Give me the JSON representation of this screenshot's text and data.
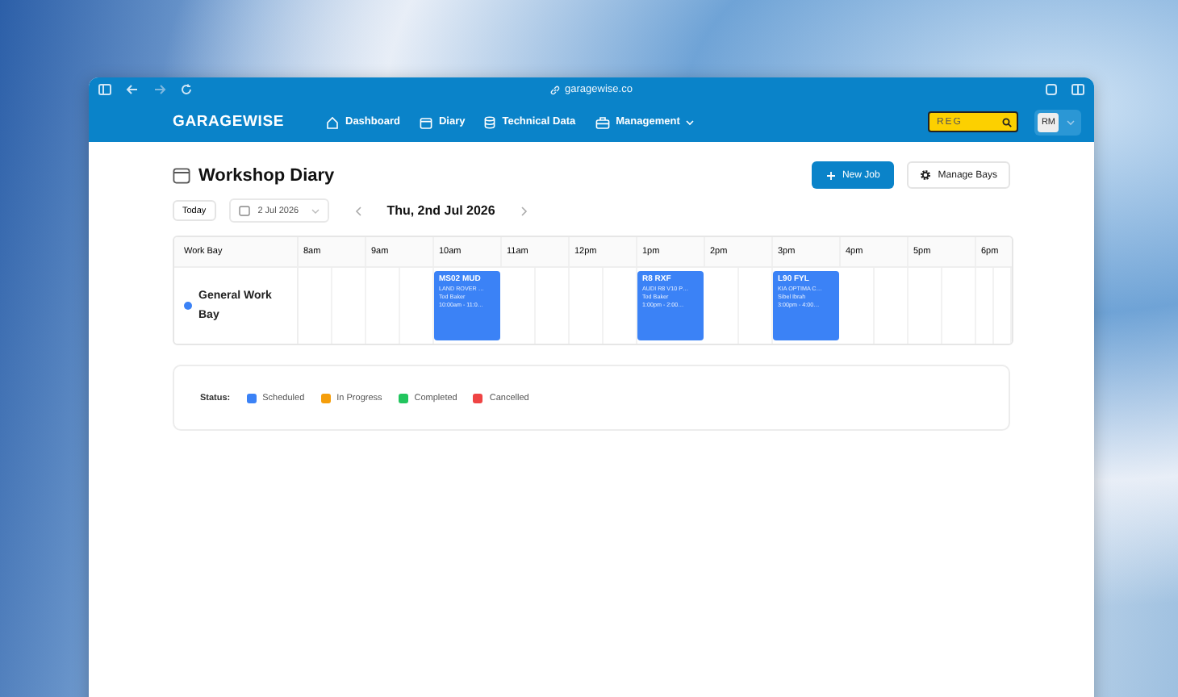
{
  "browser": {
    "address": "garagewise.co"
  },
  "nav": {
    "logo": "GARAGEWISE",
    "items": [
      {
        "label": "Dashboard",
        "kind": "link"
      },
      {
        "label": "Diary",
        "kind": "link"
      },
      {
        "label": "Technical Data",
        "kind": "link"
      },
      {
        "label": "Management",
        "kind": "menu"
      }
    ],
    "search": {
      "placeholder": "REG"
    },
    "avatar": "RM"
  },
  "page": {
    "title": "Workshop Diary",
    "new_job": "New Job",
    "manage_bays": "Manage Bays",
    "today": "Today",
    "date_field": "2 Jul 2026",
    "current_date": "Thu, 2nd Jul 2026"
  },
  "diary": {
    "bay_heading": "Work Bay",
    "hours": [
      "8am",
      "9am",
      "10am",
      "11am",
      "12pm",
      "1pm",
      "2pm",
      "3pm",
      "4pm",
      "5pm",
      "6pm"
    ],
    "bays": [
      {
        "name": "General Work Bay",
        "color": "#3b82f6",
        "slots": [
          {
            "kind": "empty"
          },
          {
            "kind": "empty"
          },
          {
            "kind": "job",
            "reg": "MS02 MUD",
            "vehicle": "LAND ROVER …",
            "customer": "Tod Baker",
            "time": "10:00am - 11:0…",
            "color": "#3b82f6"
          },
          {
            "kind": "empty"
          },
          {
            "kind": "empty"
          },
          {
            "kind": "job",
            "reg": "R8 RXF",
            "vehicle": "AUDI R8 V10 P…",
            "customer": "Tod Baker",
            "time": "1:00pm - 2:00…",
            "color": "#3b82f6"
          },
          {
            "kind": "empty"
          },
          {
            "kind": "job",
            "reg": "L90 FYL",
            "vehicle": "KIA OPTIMA C…",
            "customer": "Sibel Ibrah",
            "time": "3:00pm - 4:00…",
            "color": "#3b82f6"
          },
          {
            "kind": "empty"
          },
          {
            "kind": "empty"
          },
          {
            "kind": "empty"
          }
        ]
      }
    ]
  },
  "legend": {
    "label": "Status:",
    "items": [
      {
        "label": "Scheduled",
        "color": "#3b82f6"
      },
      {
        "label": "In Progress",
        "color": "#f59e0b"
      },
      {
        "label": "Completed",
        "color": "#22c55e"
      },
      {
        "label": "Cancelled",
        "color": "#ef4444"
      }
    ]
  }
}
